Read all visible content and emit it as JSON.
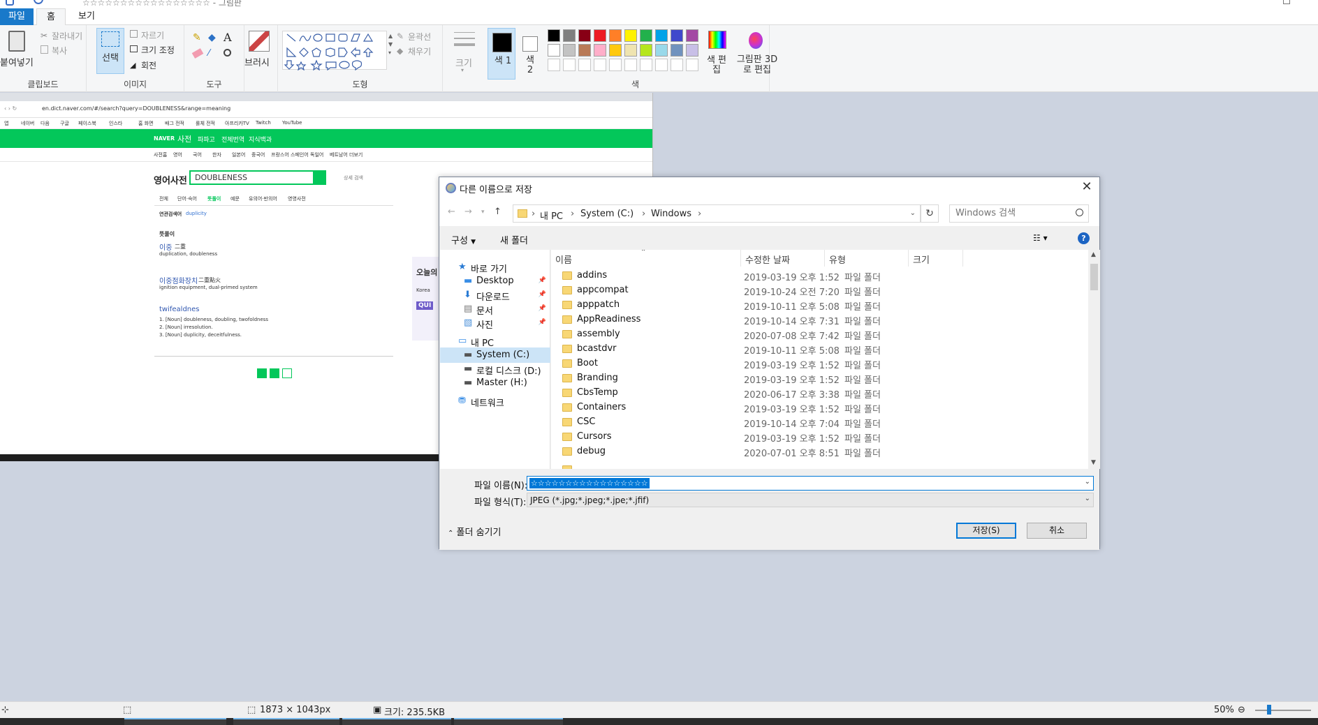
{
  "app": {
    "title": "☆☆☆☆☆☆☆☆☆☆☆☆☆☆☆☆☆ - 그림판"
  },
  "ribbon": {
    "tabs": [
      "파일",
      "홈",
      "보기"
    ],
    "clipboard": {
      "paste": "붙여넣기",
      "cut": "잘라내기",
      "copy": "복사",
      "label": "클립보드"
    },
    "image": {
      "select": "선택",
      "crop": "자르기",
      "resize": "크기 조정",
      "rotate": "회전",
      "label": "이미지"
    },
    "tools": {
      "label": "도구"
    },
    "brush": {
      "label": "브러시"
    },
    "shapes": {
      "outline": "윤곽선",
      "fill": "채우기",
      "label": "도형"
    },
    "size": {
      "label": "크기"
    },
    "color1": {
      "label": "색 1"
    },
    "color2": {
      "label": "색 2"
    },
    "colors": {
      "label": "색",
      "edit": "색 편집",
      "row1": [
        "#000000",
        "#7f7f7f",
        "#880015",
        "#ed1c24",
        "#ff7f27",
        "#fff200",
        "#22b14c",
        "#00a2e8",
        "#3f48cc",
        "#a349a4"
      ],
      "row2": [
        "#ffffff",
        "#c3c3c3",
        "#b97a57",
        "#ffaec9",
        "#ffc90e",
        "#efe4b0",
        "#b5e61d",
        "#99d9ea",
        "#7092be",
        "#c8bfe7"
      ]
    },
    "paint3d": {
      "label": "그림판 3D로 편집"
    }
  },
  "browser": {
    "url": "en.dict.naver.com/#/search?query=DOUBLENESS&range=meaning",
    "bookmarks": [
      "앱",
      "네이버",
      "다음",
      "구글",
      "페이스북",
      "인스타",
      "홈 화면",
      "배그 전적",
      "롤체 전적",
      "아프리카TV",
      "Twitch",
      "YouTube"
    ],
    "nav": [
      "NAVER",
      "사전",
      "파파고",
      "전체번역",
      "지식백과"
    ],
    "subnav": [
      "사전홈",
      "영어",
      "국어",
      "한자",
      "일본어",
      "중국어",
      "프랑스어",
      "스페인어",
      "독일어",
      "베트남어",
      "더보기"
    ],
    "dict_title": "영어사전",
    "query": "DOUBLENESS",
    "detail_search": "상세 검색",
    "result_tabs": [
      "전체",
      "단어·숙어",
      "뜻풀이",
      "예문",
      "유의어·반의어",
      "영영사전"
    ],
    "related_label": "연관검색어",
    "related": "duplicity",
    "section": "뜻풀이",
    "entries": [
      {
        "word": "이중",
        "hanja": "二重",
        "def": "duplication, doubleness"
      },
      {
        "word": "이중점화장치",
        "hanja": "二重點火",
        "def": "ignition equipment, dual-primed system"
      },
      {
        "word": "twifealdnes",
        "hanja": "",
        "def": "1. [Noun] doubleness, doubling, twofoldness"
      }
    ],
    "more_defs": [
      "2. [Noun] irresolution.",
      "3. [Noun] duplicity, deceitfulness."
    ],
    "side_snippets": [
      "오늘의",
      "Korea",
      "QUI"
    ]
  },
  "dialog": {
    "title": "다른 이름으로 저장",
    "breadcrumbs": [
      "내 PC",
      "System (C:)",
      "Windows"
    ],
    "search_placeholder": "Windows 검색",
    "organize": "구성",
    "new_folder": "새 폴더",
    "nav": [
      {
        "label": "바로 가기"
      },
      {
        "label": "Desktop"
      },
      {
        "label": "다운로드"
      },
      {
        "label": "문서"
      },
      {
        "label": "사진"
      },
      {
        "label": "내 PC"
      },
      {
        "label": "System (C:)"
      },
      {
        "label": "로컬 디스크 (D:)"
      },
      {
        "label": "Master (H:)"
      },
      {
        "label": "네트워크"
      }
    ],
    "columns": [
      "이름",
      "수정한 날짜",
      "유형",
      "크기"
    ],
    "files": [
      {
        "name": "addins",
        "date": "2019-03-19 오후 1:52",
        "type": "파일 폴더"
      },
      {
        "name": "appcompat",
        "date": "2019-10-24 오전 7:20",
        "type": "파일 폴더"
      },
      {
        "name": "apppatch",
        "date": "2019-10-11 오후 5:08",
        "type": "파일 폴더"
      },
      {
        "name": "AppReadiness",
        "date": "2019-10-14 오후 7:31",
        "type": "파일 폴더"
      },
      {
        "name": "assembly",
        "date": "2020-07-08 오후 7:42",
        "type": "파일 폴더"
      },
      {
        "name": "bcastdvr",
        "date": "2019-10-11 오후 5:08",
        "type": "파일 폴더"
      },
      {
        "name": "Boot",
        "date": "2019-03-19 오후 1:52",
        "type": "파일 폴더"
      },
      {
        "name": "Branding",
        "date": "2019-03-19 오후 1:52",
        "type": "파일 폴더"
      },
      {
        "name": "CbsTemp",
        "date": "2020-06-17 오후 3:38",
        "type": "파일 폴더"
      },
      {
        "name": "Containers",
        "date": "2019-03-19 오후 1:52",
        "type": "파일 폴더"
      },
      {
        "name": "CSC",
        "date": "2019-10-14 오후 7:04",
        "type": "파일 폴더"
      },
      {
        "name": "Cursors",
        "date": "2019-03-19 오후 1:52",
        "type": "파일 폴더"
      },
      {
        "name": "debug",
        "date": "2020-07-01 오후 8:51",
        "type": "파일 폴더"
      }
    ],
    "filename_label": "파일 이름(N):",
    "filename_value": "☆☆☆☆☆☆☆☆☆☆☆☆☆☆☆☆☆",
    "filetype_label": "파일 형식(T):",
    "filetype_value": "JPEG (*.jpg;*.jpeg;*.jpe;*.jfif)",
    "hide_folders": "폴더 숨기기",
    "save": "저장(S)",
    "cancel": "취소"
  },
  "status": {
    "dimensions": "1873 × 1043px",
    "size": "크기: 235.5KB",
    "zoom": "50%"
  }
}
